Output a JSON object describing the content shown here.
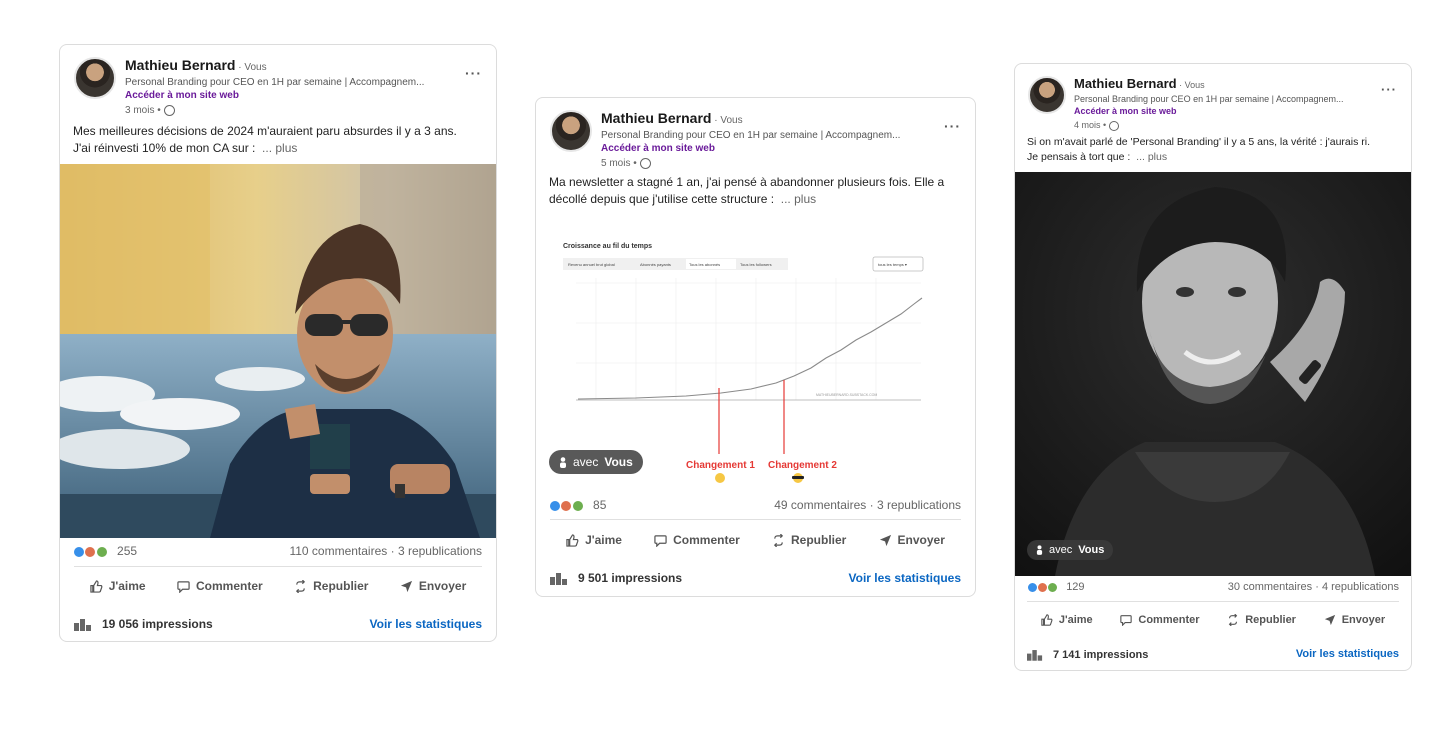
{
  "posts": [
    {
      "author": "Mathieu Bernard",
      "relation": " · Vous",
      "headline": "Personal Branding pour CEO en 1H par semaine | Accompagnem...",
      "site_link": "Accéder à mon site web",
      "age": "3 mois •",
      "menu": "···",
      "text_line1": "Mes meilleures décisions de 2024 m'auraient paru absurdes il y a 3 ans.",
      "text_line2": "J'ai réinvesti 10% de mon CA sur :",
      "more": "... plus",
      "reactions_count": "255",
      "comments": "110 commentaires",
      "reposts": "3 republications",
      "actions": {
        "like": "J'aime",
        "comment": "Commenter",
        "repost": "Republier",
        "send": "Envoyer"
      },
      "impressions": "19 056 impressions",
      "stats_link": "Voir les statistiques"
    },
    {
      "author": "Mathieu Bernard",
      "relation": " · Vous",
      "headline": "Personal Branding pour CEO en 1H par semaine | Accompagnem...",
      "site_link": "Accéder à mon site web",
      "age": "5 mois •",
      "menu": "···",
      "text_line1": "Ma newsletter a stagné 1 an, j'ai pensé à abandonner plusieurs fois. Elle a",
      "text_line2": "décollé depuis que j'utilise cette structure :",
      "more": "... plus",
      "reactions_count": "85",
      "comments": "49 commentaires",
      "reposts": "3 republications",
      "actions": {
        "like": "J'aime",
        "comment": "Commenter",
        "repost": "Republier",
        "send": "Envoyer"
      },
      "impressions": "9 501 impressions",
      "stats_link": "Voir les statistiques",
      "tag": {
        "prefix": "avec",
        "name": "Vous"
      },
      "embedded_chart": {
        "title": "Croissance au fil du temps",
        "tabs": [
          "Revenu annuel brut global",
          "Abonnés payants",
          "Tous les abonnés",
          "Tous les followers"
        ],
        "range_button": "tous les temps ▾",
        "watermark": "MATHIEUBERNARD.SUBSTACK.COM",
        "annotation1": "Changement 1",
        "annotation2": "Changement 2",
        "line_color": "#999999",
        "annotation_color": "#e53935"
      }
    },
    {
      "author": "Mathieu Bernard",
      "relation": " · Vous",
      "headline": "Personal Branding pour CEO en 1H par semaine | Accompagnem...",
      "site_link": "Accéder à mon site web",
      "age": "4 mois •",
      "menu": "···",
      "text_line1": "Si on m'avait parlé de 'Personal Branding' il y a 5 ans, la vérité : j'aurais ri.",
      "text_line2": "Je pensais à tort que :",
      "more": "... plus",
      "reactions_count": "129",
      "comments": "30 commentaires",
      "reposts": "4 republications",
      "actions": {
        "like": "J'aime",
        "comment": "Commenter",
        "repost": "Republier",
        "send": "Envoyer"
      },
      "impressions": "7 141 impressions",
      "stats_link": "Voir les statistiques",
      "tag": {
        "prefix": "avec",
        "name": "Vous"
      }
    }
  ],
  "colors": {
    "link_blue": "#0a66c2",
    "site_purple": "#6a1b9a",
    "like_blue": "#378fe9",
    "love_red": "#df704d",
    "support_green": "#6dae4f"
  }
}
